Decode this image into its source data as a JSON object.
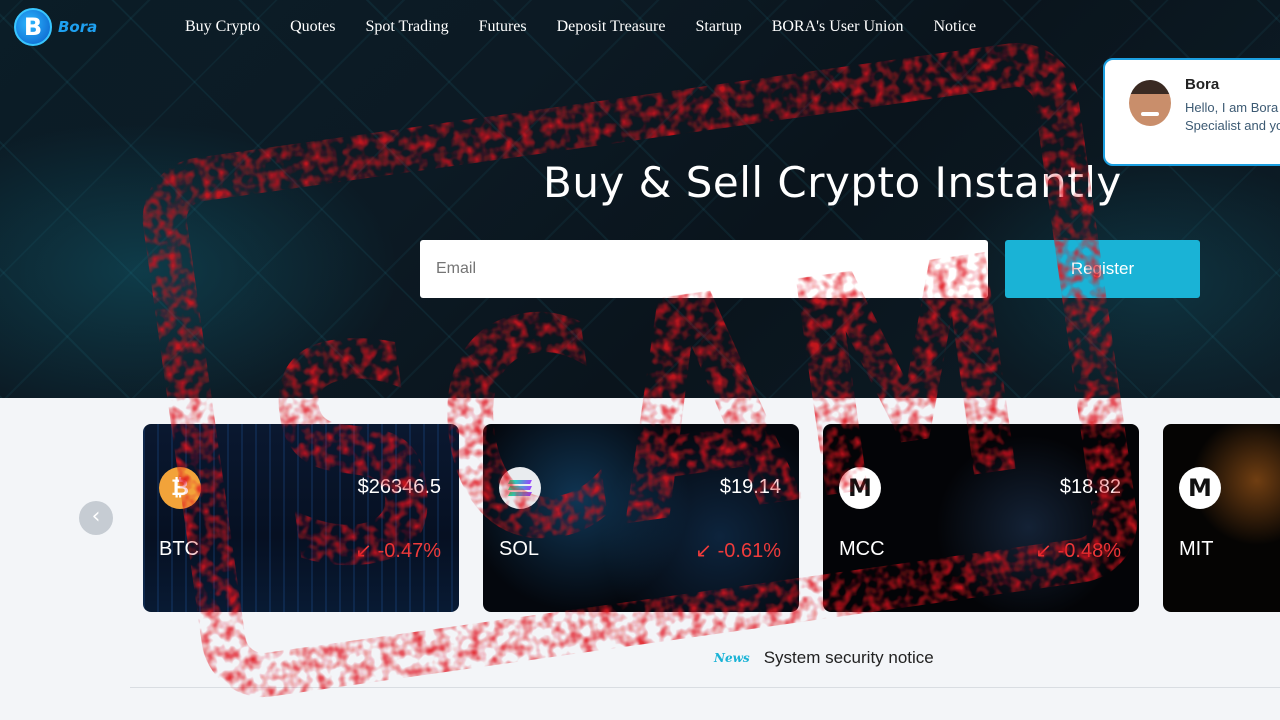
{
  "brand": {
    "logo_letter": "B",
    "logo_text": "Bora"
  },
  "nav": {
    "items": [
      {
        "label": "Buy Crypto"
      },
      {
        "label": "Quotes"
      },
      {
        "label": "Spot Trading"
      },
      {
        "label": "Futures"
      },
      {
        "label": "Deposit Treasure"
      },
      {
        "label": "Startup"
      },
      {
        "label": "BORA's User Union"
      },
      {
        "label": "Notice"
      }
    ]
  },
  "chat": {
    "name": "Bora",
    "message": "Hello, I am Bora Specialist and you."
  },
  "hero": {
    "title": "Buy & Sell Crypto Instantly",
    "email_placeholder": "Email",
    "register_label": "Register"
  },
  "tickers": {
    "prev_icon": "chevron-left-icon",
    "cards": [
      {
        "symbol": "BTC",
        "price": "$26346.5",
        "change": "-0.47%",
        "arrow": "↙",
        "icon": "bitcoin-icon"
      },
      {
        "symbol": "SOL",
        "price": "$19.14",
        "change": "-0.61%",
        "arrow": "↙",
        "icon": "solana-icon"
      },
      {
        "symbol": "MCC",
        "price": "$18.82",
        "change": "-0.48%",
        "arrow": "↙",
        "icon": "m-coin-icon"
      },
      {
        "symbol": "MIT",
        "price": "",
        "change": "",
        "arrow": "",
        "icon": "m-coin-icon"
      }
    ]
  },
  "news": {
    "badge": "News",
    "text": "System security notice"
  },
  "stamp": {
    "text": "SCAM",
    "color": "#e0141e"
  },
  "colors": {
    "accent": "#1ab3d6",
    "negative": "#ef3b3b"
  }
}
